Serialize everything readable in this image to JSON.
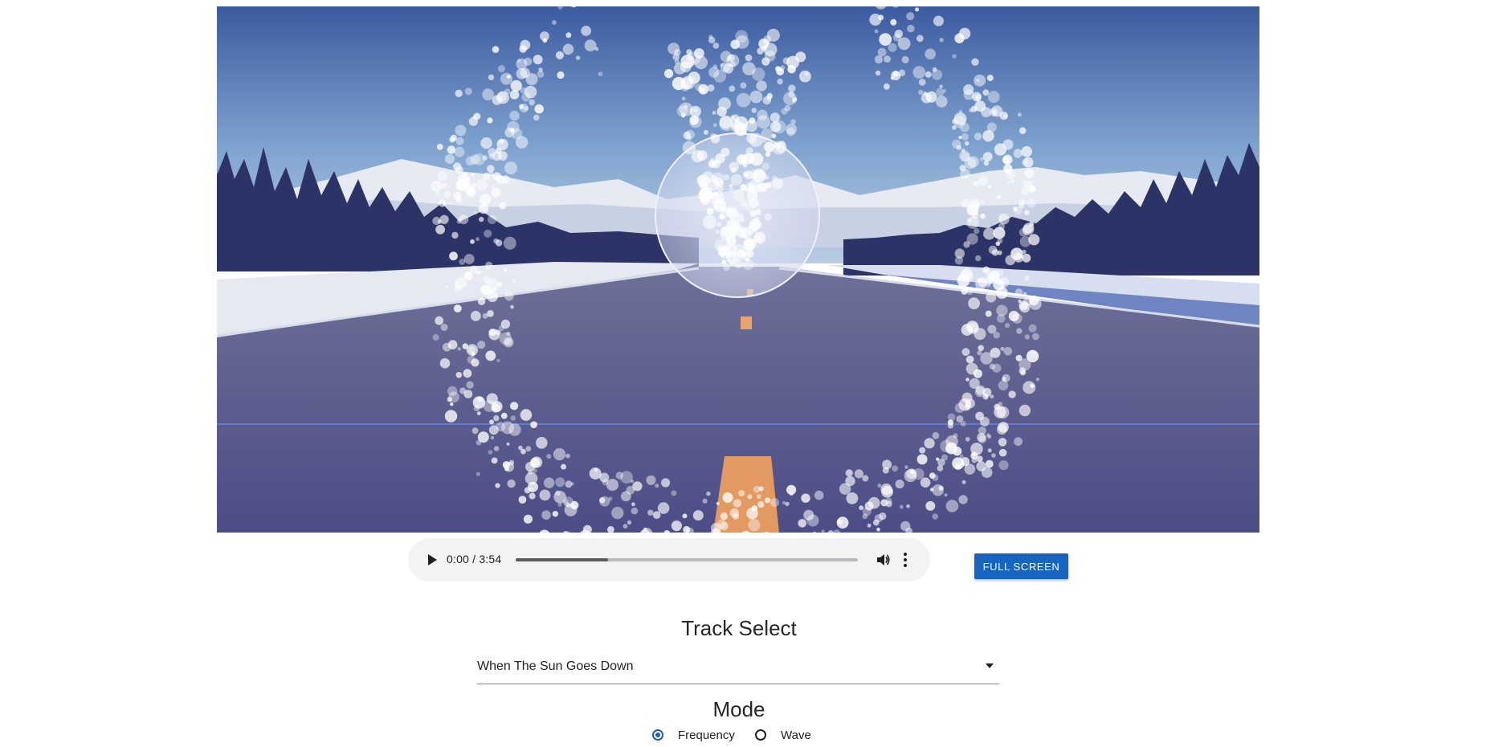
{
  "player": {
    "time_display": "0:00 / 3:54",
    "buffered_fraction": 0.27,
    "play_icon": "play-icon",
    "volume_icon": "volume-icon",
    "more_icon": "more-vertical-icon"
  },
  "fullscreen_button": {
    "label": "FULL SCREEN",
    "color": "#1765c0"
  },
  "track_select": {
    "heading": "Track Select",
    "selected": "When The Sun Goes Down",
    "caret_icon": "caret-down-icon"
  },
  "mode": {
    "heading": "Mode",
    "options": [
      {
        "label": "Frequency",
        "checked": true
      },
      {
        "label": "Wave",
        "checked": false
      }
    ],
    "accent": "#1d5fb0"
  },
  "visualizer": {
    "background": "road through snowy pine forest with mountains",
    "tint": "#4a4f9c"
  }
}
